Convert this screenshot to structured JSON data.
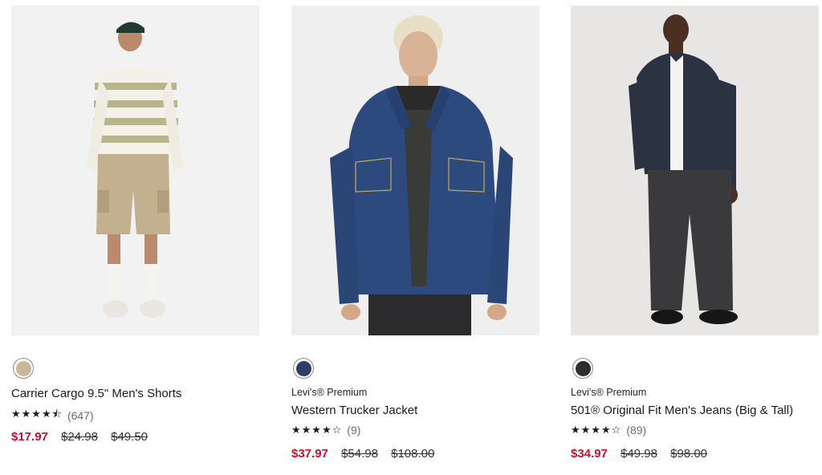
{
  "products": [
    {
      "brand": "",
      "name": "Carrier Cargo 9.5\" Men's Shorts",
      "stars": "★★★★⯪",
      "rating_count": "(647)",
      "sale_price": "$17.97",
      "was_price_1": "$24.98",
      "was_price_2": "$49.50",
      "swatch_color": "#c9b89a"
    },
    {
      "brand": "Levi's® Premium",
      "name": "Western Trucker Jacket",
      "stars": "★★★★☆",
      "rating_count": "(9)",
      "sale_price": "$37.97",
      "was_price_1": "$54.98",
      "was_price_2": "$108.00",
      "swatch_color": "#2c3d66"
    },
    {
      "brand": "Levi's® Premium",
      "name": "501® Original Fit Men's Jeans (Big & Tall)",
      "stars": "★★★★☆",
      "rating_count": "(89)",
      "sale_price": "$34.97",
      "was_price_1": "$49.98",
      "was_price_2": "$98.00",
      "swatch_color": "#2e2e30"
    }
  ],
  "colors": {
    "sale": "#c41230"
  }
}
